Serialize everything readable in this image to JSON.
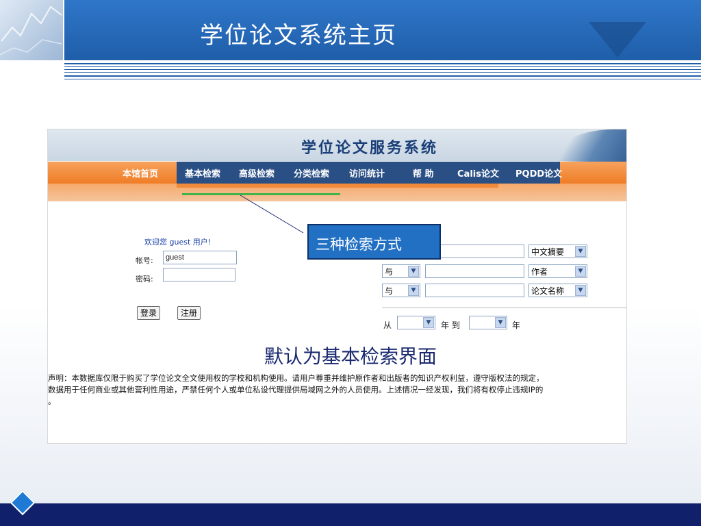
{
  "slide": {
    "title": "学位论文系统主页",
    "accent_color": "#1f5ea9",
    "bottom_bar_color": "#11206a"
  },
  "site": {
    "system_title": "学位论文服务系统",
    "nav_items": [
      "本馆首页",
      "基本检索",
      "高级检索",
      "分类检索",
      "访问统计",
      "帮 助",
      "Calis论文",
      "PQDD论文"
    ]
  },
  "login": {
    "welcome": "欢迎您 guest 用户!",
    "account_label": "帐号:",
    "account_value": "guest",
    "password_label": "密码:",
    "login_button": "登录",
    "register_button": "注册"
  },
  "search": {
    "rows": [
      {
        "operator": "",
        "field": "中文摘要"
      },
      {
        "operator": "与",
        "field": "作者"
      },
      {
        "operator": "与",
        "field": "论文名称"
      }
    ],
    "year_from_label": "从",
    "year_mid_label": "年 到",
    "year_end_label": "年",
    "year_from_value": "",
    "year_to_value": ""
  },
  "annotations": {
    "callout": "三种检索方式",
    "default_note": "默认为基本检索界面"
  },
  "disclaimer": {
    "line1": "声明：本数据库仅限于购买了学位论文全文使用权的学校和机构使用。请用户尊重并维护原作者和出版者的知识产权利益，遵守版权法的规定，",
    "line2": "数据用于任何商业或其他营利性用途，严禁任何个人或单位私设代理提供局域网之外的人员使用。上述情况一经发现，我们将有权停止违规IP的",
    "line3": "。"
  }
}
